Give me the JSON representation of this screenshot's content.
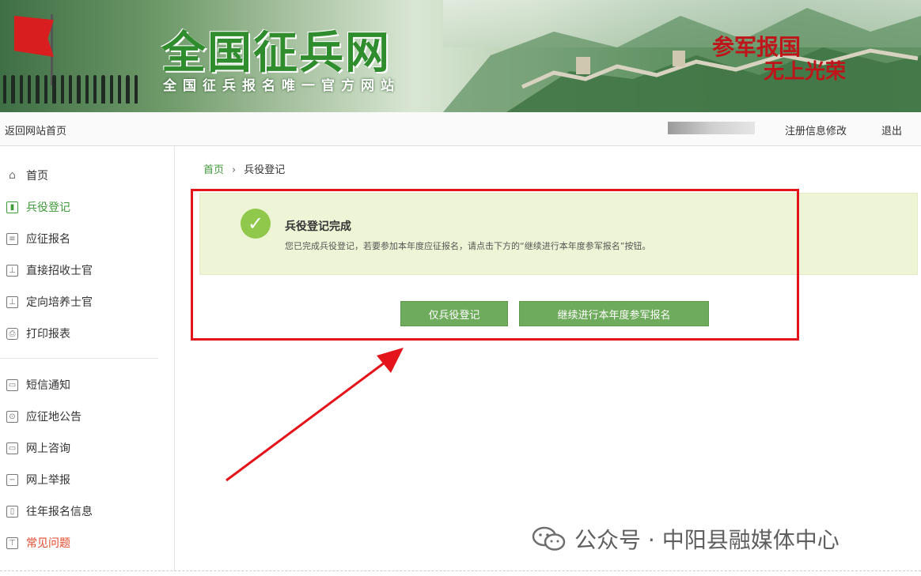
{
  "banner": {
    "title": "全国征兵网",
    "subtitle": "全国征兵报名唯一官方网站",
    "slogan_top": "参军报国",
    "slogan_bottom": "无上光荣"
  },
  "topnav": {
    "home_link": "返回网站首页",
    "edit_info": "注册信息修改",
    "logout": "退出"
  },
  "sidebar": {
    "items": [
      {
        "label": "首页",
        "icon": "home-icon"
      },
      {
        "label": "兵役登记",
        "icon": "register-icon"
      },
      {
        "label": "应征报名",
        "icon": "form-icon"
      },
      {
        "label": "直接招收士官",
        "icon": "form-icon"
      },
      {
        "label": "定向培养士官",
        "icon": "form-icon"
      },
      {
        "label": "打印报表",
        "icon": "printer-icon"
      },
      {
        "label": "短信通知",
        "icon": "message-icon"
      },
      {
        "label": "应征地公告",
        "icon": "notice-icon"
      },
      {
        "label": "网上咨询",
        "icon": "chat-icon"
      },
      {
        "label": "网上举报",
        "icon": "report-icon"
      },
      {
        "label": "往年报名信息",
        "icon": "history-icon"
      },
      {
        "label": "常见问题",
        "icon": "faq-icon"
      }
    ]
  },
  "breadcrumb": {
    "home": "首页",
    "separator": "›",
    "current": "兵役登记"
  },
  "notice": {
    "title": "兵役登记完成",
    "text": "您已完成兵役登记，若要参加本年度应征报名，请点击下方的“继续进行本年度参军报名”按钮。"
  },
  "buttons": {
    "only_register": "仅兵役登记",
    "continue": "继续进行本年度参军报名"
  },
  "watermark": {
    "text": "公众号 · 中阳县融媒体中心"
  },
  "colors": {
    "accent_green": "#3f9a3a",
    "button_green": "#6fab5c",
    "highlight_red": "#e4141b",
    "notice_bg": "#eef5d6"
  }
}
